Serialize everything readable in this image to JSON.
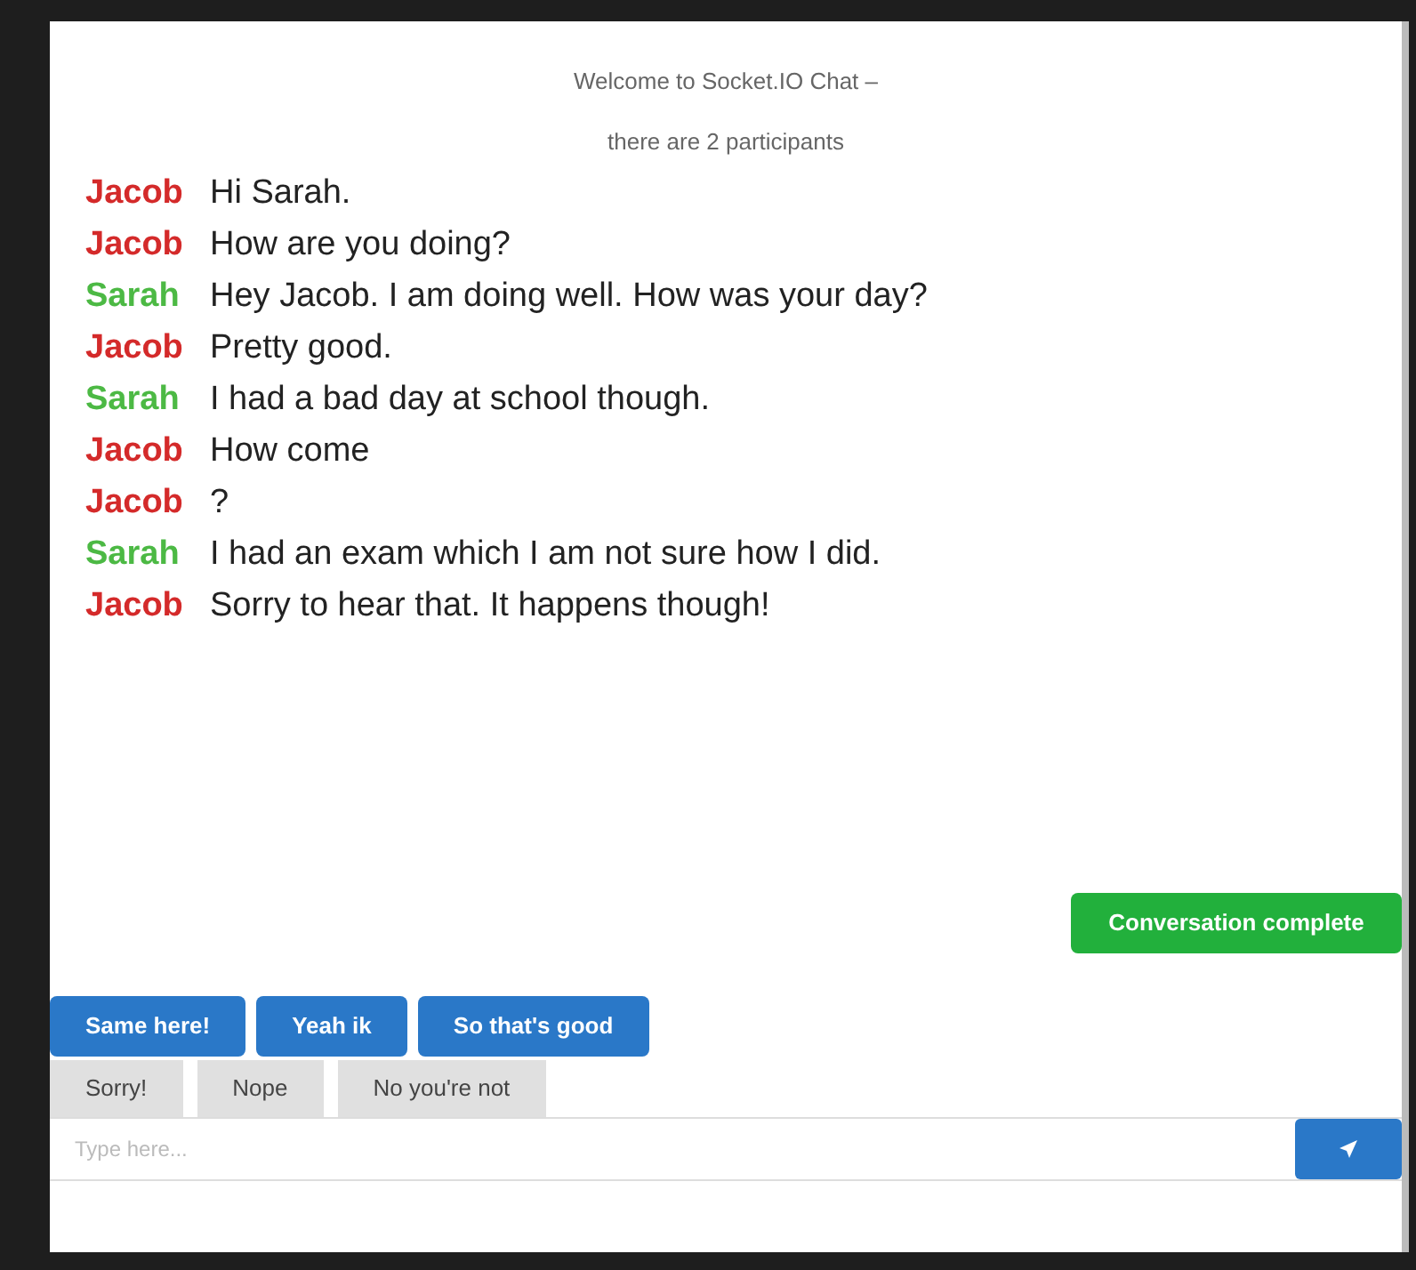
{
  "header": {
    "title": "Welcome to Socket.IO Chat –",
    "subtitle": "there are 2 participants"
  },
  "messages": [
    {
      "sender": "Jacob",
      "color": "#d42a2a",
      "text": "Hi Sarah."
    },
    {
      "sender": "Jacob",
      "color": "#d42a2a",
      "text": "How are you doing?"
    },
    {
      "sender": "Sarah",
      "color": "#4cb944",
      "text": "Hey Jacob. I am doing well. How was your day?"
    },
    {
      "sender": "Jacob",
      "color": "#d42a2a",
      "text": "Pretty good."
    },
    {
      "sender": "Sarah",
      "color": "#4cb944",
      "text": "I had a bad day at school though."
    },
    {
      "sender": "Jacob",
      "color": "#d42a2a",
      "text": "How come"
    },
    {
      "sender": "Jacob",
      "color": "#d42a2a",
      "text": "?"
    },
    {
      "sender": "Sarah",
      "color": "#4cb944",
      "text": "I had an exam which I am not sure how I did."
    },
    {
      "sender": "Jacob",
      "color": "#d42a2a",
      "text": "Sorry to hear that. It happens though!"
    }
  ],
  "status_button": "Conversation complete",
  "quick_replies": [
    {
      "label": "Same here!",
      "kind": "primary"
    },
    {
      "label": "Yeah ik",
      "kind": "primary"
    },
    {
      "label": "So that's good",
      "kind": "primary"
    }
  ],
  "suggestions": [
    {
      "label": "Sorry!",
      "kind": "secondary"
    },
    {
      "label": "Nope",
      "kind": "secondary"
    },
    {
      "label": "No you're not",
      "kind": "secondary"
    }
  ],
  "input": {
    "placeholder": "Type here..."
  }
}
